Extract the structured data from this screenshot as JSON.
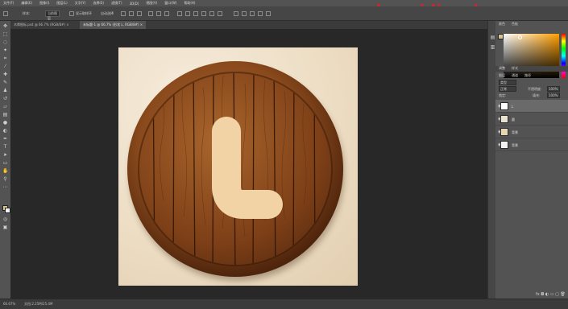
{
  "menubar": {
    "items": [
      "文件(F)",
      "编辑(E)",
      "图像(I)",
      "图层(L)",
      "文字(Y)",
      "选择(S)",
      "滤镜(T)",
      "3D(D)",
      "视图(V)",
      "窗口(W)",
      "帮助(H)"
    ]
  },
  "watermark": "www.haoyidianshe.com",
  "options": {
    "sample_label": "样本:",
    "sample_value": "当前图层",
    "show_label": "显示取样环",
    "auto_label": "自动选择",
    "transform_label": "显示变换控件",
    "search_icon": "search-icon"
  },
  "tabs": [
    {
      "label": "木牌图标.psd @ 66.7% (RGB/8#) ×",
      "active": false
    },
    {
      "label": "未标题-1 @ 66.7% (形状 L, RGB/8#) ×",
      "active": true
    }
  ],
  "status": {
    "zoom": "66.67%",
    "doc": "文档:2.25M/25.4M"
  },
  "panels": {
    "color_tabs": [
      "颜色",
      "色板"
    ],
    "adjust_tabs": [
      "调整",
      "样式"
    ],
    "layers_tabs": [
      "图层",
      "通道",
      "路径"
    ],
    "kind_label": "类型",
    "mode_label": "正常",
    "opacity_label": "不透明度:",
    "opacity_value": "100%",
    "lock_label": "锁定:",
    "fill_label": "填充:",
    "fill_value": "100%",
    "foot_icons": "fx ◘ ◐ ▭ ▢ 🗑"
  },
  "layers": [
    {
      "name": "L",
      "selected": true,
      "thumb": "#ffffff"
    },
    {
      "name": "圆",
      "selected": false,
      "thumb": "#e9e2cf"
    },
    {
      "name": "背景",
      "selected": false,
      "thumb": "#e6d6b4"
    },
    {
      "name": "背景",
      "selected": false,
      "thumb": "#f2f2f2"
    }
  ],
  "colors": {
    "foreground": "#d6c293",
    "background": "#f2f2f2",
    "letter_fill": "#f2d3a6",
    "wood_dark": "#5a2c10",
    "wood_light": "#a9652c",
    "paper": "#ecdcc2"
  }
}
